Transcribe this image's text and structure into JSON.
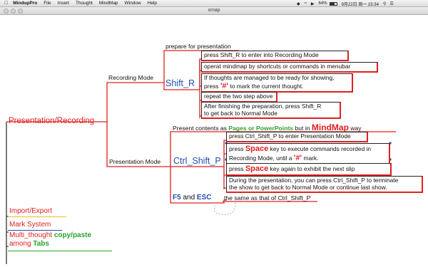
{
  "menubar": {
    "app": "MindupPro",
    "menus": [
      "File",
      "Insert",
      "Thought",
      "MindMap",
      "Window",
      "Help"
    ],
    "battery": "64%",
    "datetime": "9月22日 周一  15:34"
  },
  "window": {
    "title": "xmap"
  },
  "central": {
    "label": "Presentation/Recording"
  },
  "recording": {
    "label": "Recording Mode",
    "prepare": "prepare for presentation",
    "shortcut": "Shift_R",
    "items": {
      "enter": "press Shift_R to enter into Recording Mode",
      "operate": "operat mindmap by shortcuts or commands in menubar",
      "mark_line1": "If thoughts are managed to be ready for showing,",
      "mark_pre": "press ",
      "mark_sym": "'#'",
      "mark_post": " to mark the current thought.",
      "repeat": "repeat the two step above",
      "back_line1": "After finishing the preparation, press Shift_R",
      "back_line2": "to get back to Normal Mode"
    }
  },
  "presentation": {
    "label": "Presentation Mode",
    "contents_pre": "Present contents as ",
    "contents_pages": "Pages or PowerPoints",
    "contents_mid": " but in ",
    "contents_mindmap": "MindMap",
    "contents_post": " way",
    "shortcut": "Ctrl_Shift_P",
    "items": {
      "enter": "press Ctrl_Shift_P to enter Presentation Mode",
      "space1_pre": "press ",
      "space_word": "Space",
      "space1_post": " key to execute commands recorded in",
      "space1_line2_pre": "Recording Mode, until a ",
      "space1_sym": "'#'",
      "space1_line2_post": " mark.",
      "space2_pre": "press ",
      "space2_post": " key again to exhibit the next slip",
      "during_line1": "During the presentation, you can press Ctrl_Shift_P to terminate",
      "during_line2": "the show to get back to Normal Mode or continue last show."
    },
    "f5": "F5",
    "and": " and ",
    "esc": "ESC",
    "same": "the same as that of Ctrl_Shift_P"
  },
  "left_nodes": {
    "import_export": "Import/Export",
    "mark_system": "Mark System",
    "multi_pre": "Multi_thought ",
    "multi_copy": "copy/paste",
    "multi_among": "among ",
    "multi_tabs": "Tabs"
  },
  "colors": {
    "branch": "#e02020",
    "topic": "#e02020",
    "shortcut_blue": "#1f4fb0",
    "green": "#2aa22a",
    "underline_yellow": "#e8c21a",
    "underline_blue": "#1f4fb0",
    "underline_green": "#2aa22a"
  }
}
